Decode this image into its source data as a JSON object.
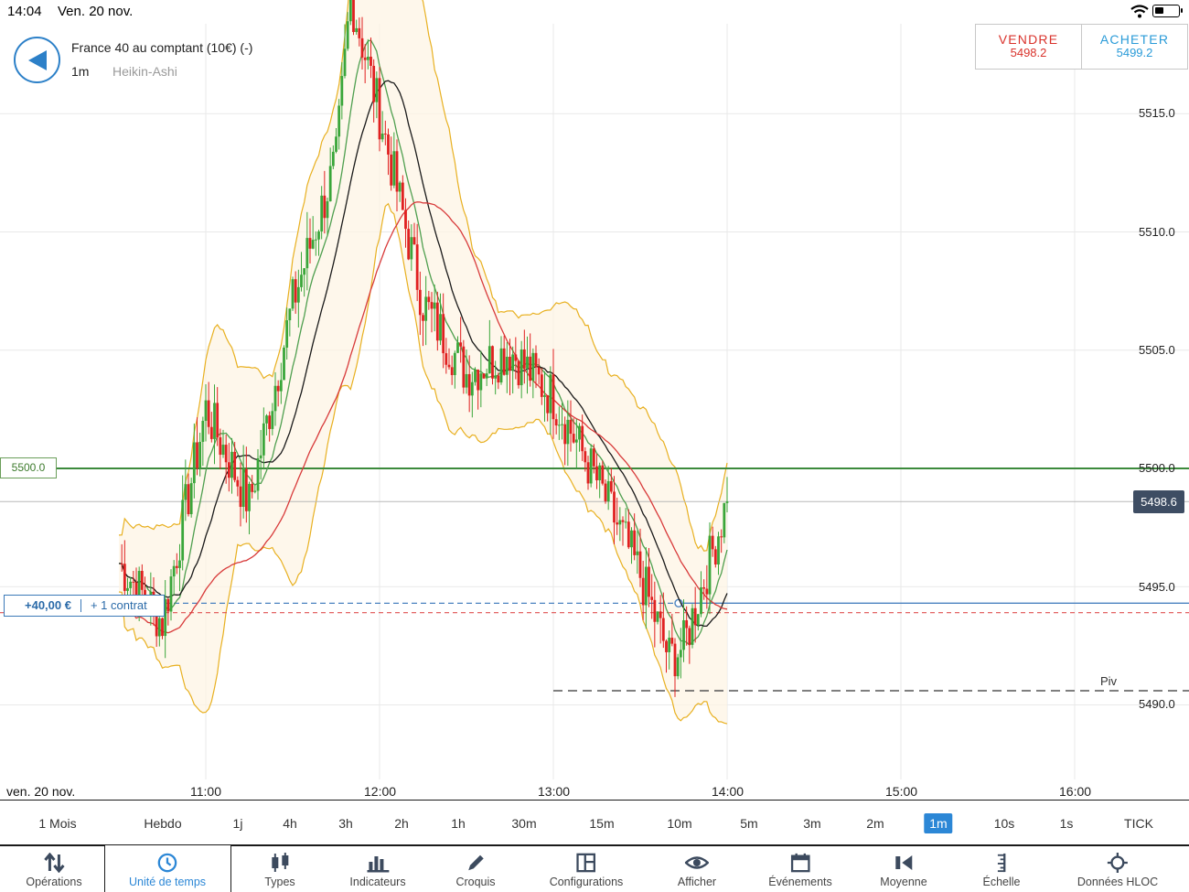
{
  "status_bar": {
    "time": "14:04",
    "date": "Ven. 20 nov."
  },
  "header": {
    "instrument": "France 40 au comptant (10€) (-)",
    "timeframe": "1m",
    "chart_type": "Heikin-Ashi"
  },
  "trade": {
    "sell_label": "VENDRE",
    "sell_price": "5498.2",
    "buy_label": "ACHETER",
    "buy_price": "5499.2"
  },
  "price_axis": {
    "labels": [
      "5515.0",
      "5510.0",
      "5505.0",
      "5500.0",
      "5495.0",
      "5490.0"
    ],
    "current_price": "5498.6"
  },
  "levels": {
    "alert_label": "5500.0",
    "position_pnl": "+40,00 €",
    "position_size": "+ 1 contrat",
    "pivot_label": "Piv"
  },
  "time_axis": {
    "date": "ven. 20 nov.",
    "labels": [
      "11:00",
      "12:00",
      "13:00",
      "14:00",
      "15:00",
      "16:00"
    ]
  },
  "timeframes": {
    "items": [
      "1 Mois",
      "Hebdo",
      "1j",
      "4h",
      "3h",
      "2h",
      "1h",
      "30m",
      "15m",
      "10m",
      "5m",
      "3m",
      "2m",
      "1m",
      "10s",
      "1s",
      "TICK"
    ],
    "active": "1m"
  },
  "toolbar": {
    "items": [
      {
        "label": "Opérations",
        "icon": "arrows-updown-icon"
      },
      {
        "label": "Unité de temps",
        "icon": "clock-icon"
      },
      {
        "label": "Types",
        "icon": "candles-icon"
      },
      {
        "label": "Indicateurs",
        "icon": "bar-chart-icon"
      },
      {
        "label": "Croquis",
        "icon": "pencil-icon"
      },
      {
        "label": "Configurations",
        "icon": "layout-icon"
      },
      {
        "label": "Afficher",
        "icon": "eye-icon"
      },
      {
        "label": "Événements",
        "icon": "calendar-icon"
      },
      {
        "label": "Moyenne",
        "icon": "average-icon"
      },
      {
        "label": "Échelle",
        "icon": "ruler-icon"
      },
      {
        "label": "Données HLOC",
        "icon": "crosshair-icon"
      }
    ],
    "active": "Unité de temps"
  },
  "chart_data": {
    "type": "candlestick",
    "style": "Heikin-Ashi",
    "colors": {
      "up": "#3aa63a",
      "down": "#e02020",
      "bollinger": "#e8b020",
      "ma_fast": "#4f9f4f",
      "ma_mid": "#1a1a1a",
      "ma_slow": "#d83a3a"
    },
    "ylim": [
      5486.5,
      5518.0
    ],
    "xlim": [
      "10:28",
      "16:30"
    ],
    "horizontal_levels": {
      "alert": 5500.0,
      "current": 5498.6,
      "position_entry": 5494.3,
      "stop": 5493.9,
      "pivot": 5490.6
    },
    "trend_anchors": {
      "time": [
        "10:30",
        "10:45",
        "11:00",
        "11:15",
        "11:30",
        "11:45",
        "11:50",
        "12:00",
        "12:15",
        "12:30",
        "12:45",
        "13:00",
        "13:15",
        "13:30",
        "13:40",
        "13:45",
        "13:50",
        "14:00"
      ],
      "close": [
        5496.0,
        5493.5,
        5502.5,
        5498.5,
        5507.0,
        5513.0,
        5520.0,
        5515.0,
        5507.0,
        5504.0,
        5505.0,
        5503.0,
        5499.5,
        5495.5,
        5492.0,
        5492.5,
        5494.5,
        5498.6
      ]
    }
  }
}
